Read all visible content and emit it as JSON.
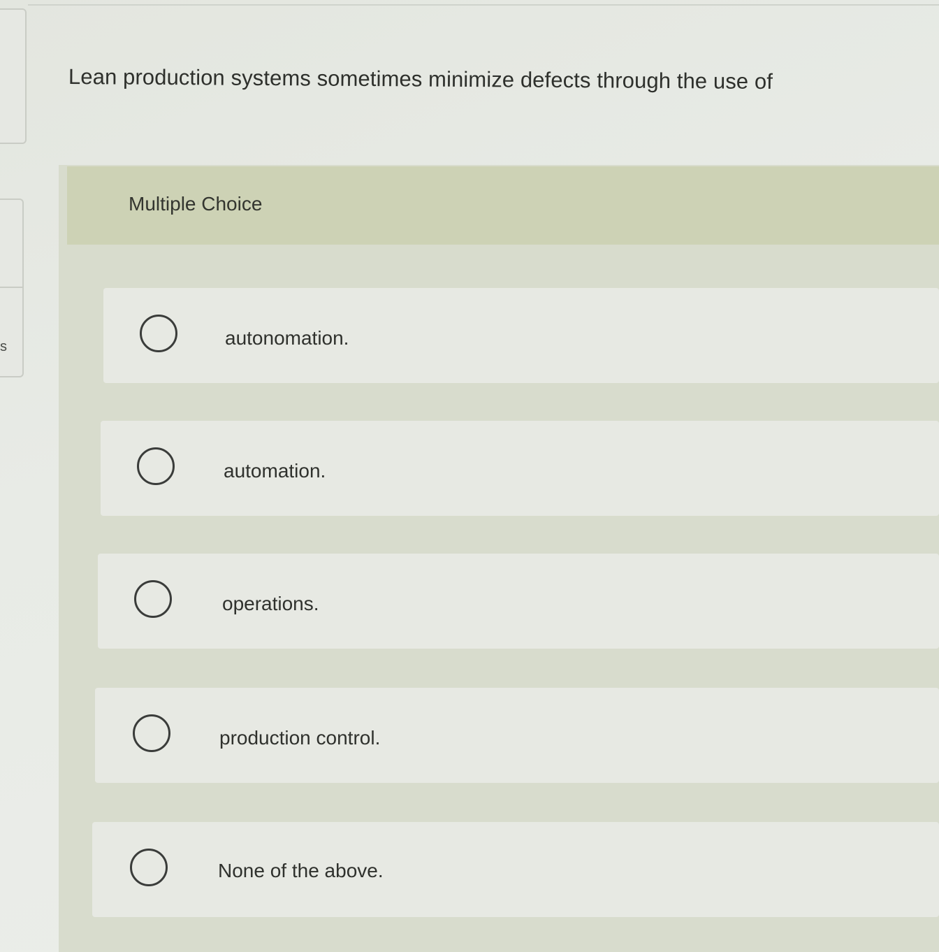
{
  "question": {
    "text": "Lean production systems sometimes minimize defects through the use of"
  },
  "side": {
    "letter": "s"
  },
  "multiple_choice": {
    "label": "Multiple Choice",
    "options": [
      {
        "label": "autonomation."
      },
      {
        "label": "automation."
      },
      {
        "label": "operations."
      },
      {
        "label": "production control."
      },
      {
        "label": "None of the above."
      }
    ]
  }
}
